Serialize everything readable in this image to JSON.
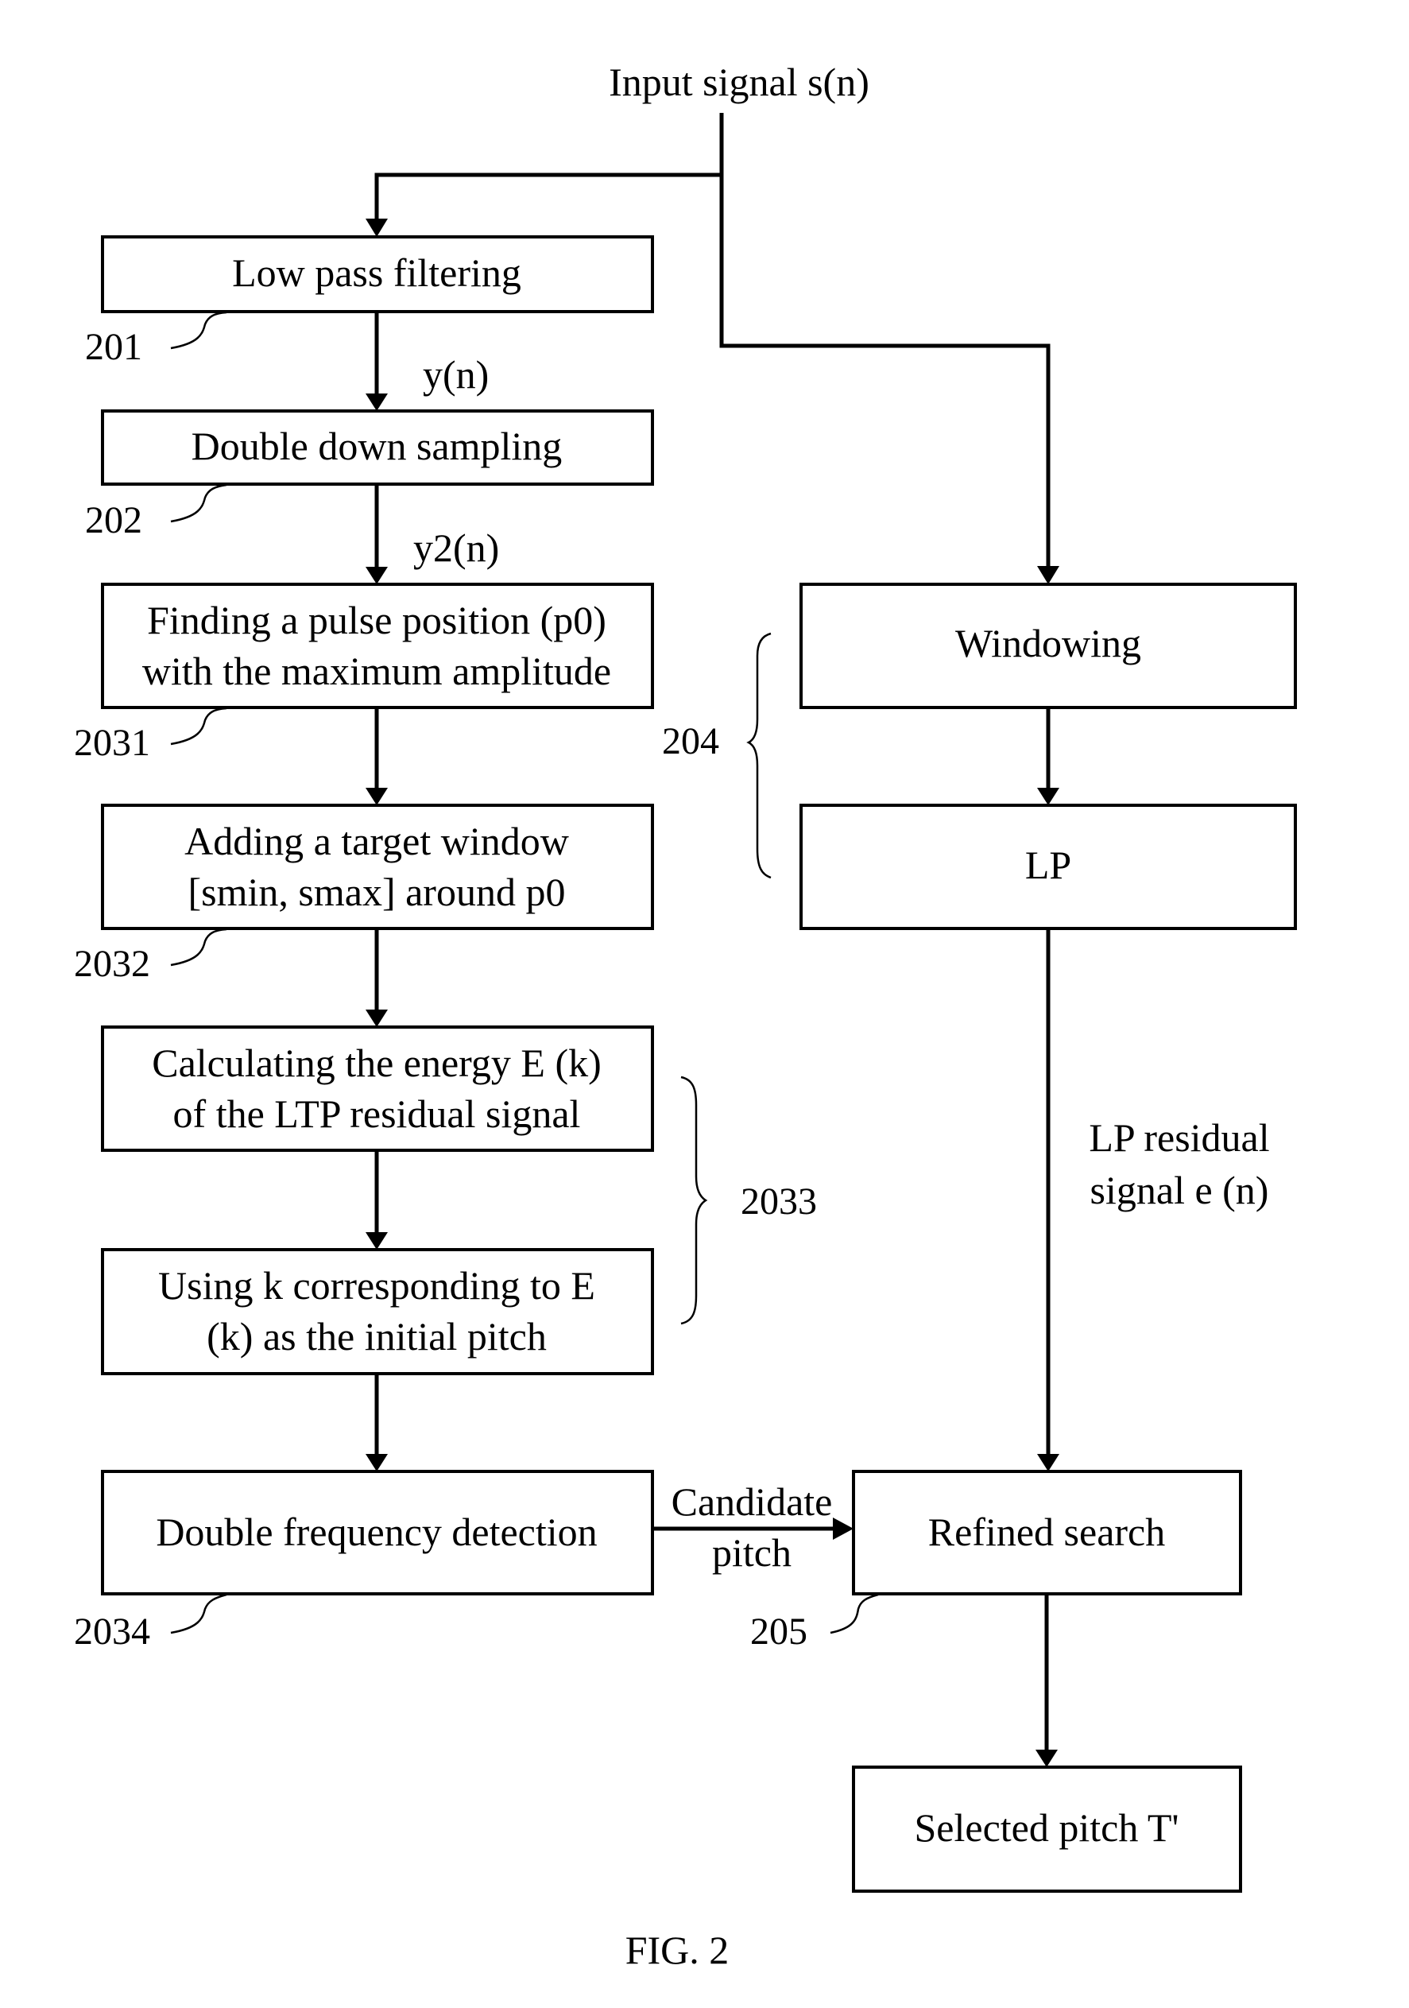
{
  "figure": {
    "caption": "FIG. 2",
    "input_label": "Input signal s(n)"
  },
  "left_column": {
    "steps": [
      {
        "id": "201",
        "lines": [
          "Low pass filtering"
        ]
      },
      {
        "id": "202",
        "lines": [
          "Double down sampling"
        ]
      },
      {
        "id": "2031",
        "lines": [
          "Finding a pulse position (p0)",
          "with the maximum amplitude"
        ]
      },
      {
        "id": "2032",
        "lines": [
          "Adding a target window",
          "[smin, smax] around p0"
        ]
      },
      {
        "id": "2033a",
        "lines": [
          "Calculating the energy E (k)",
          "of the LTP residual signal"
        ]
      },
      {
        "id": "2033b",
        "lines": [
          "Using k corresponding to E",
          "(k) as the initial pitch"
        ]
      },
      {
        "id": "2034",
        "lines": [
          "Double frequency  detection"
        ]
      }
    ],
    "signal_labels": {
      "after_201": "y(n)",
      "after_202": "y2(n)"
    },
    "ref_numbers": {
      "n201": "201",
      "n202": "202",
      "n2031": "2031",
      "n2032": "2032",
      "n2033": "2033",
      "n2034": "2034"
    }
  },
  "right_column": {
    "steps": [
      {
        "id": "windowing",
        "lines": [
          "Windowing"
        ]
      },
      {
        "id": "lp",
        "lines": [
          "LP"
        ]
      },
      {
        "id": "refined",
        "lines": [
          "Refined search"
        ]
      },
      {
        "id": "selected",
        "lines": [
          "Selected pitch T'"
        ]
      }
    ],
    "ref_numbers": {
      "n204": "204",
      "n205": "205"
    },
    "residual_label": [
      "LP residual",
      "signal e (n)"
    ]
  },
  "connector": {
    "candidate_label": [
      "Candidate",
      "pitch"
    ]
  }
}
